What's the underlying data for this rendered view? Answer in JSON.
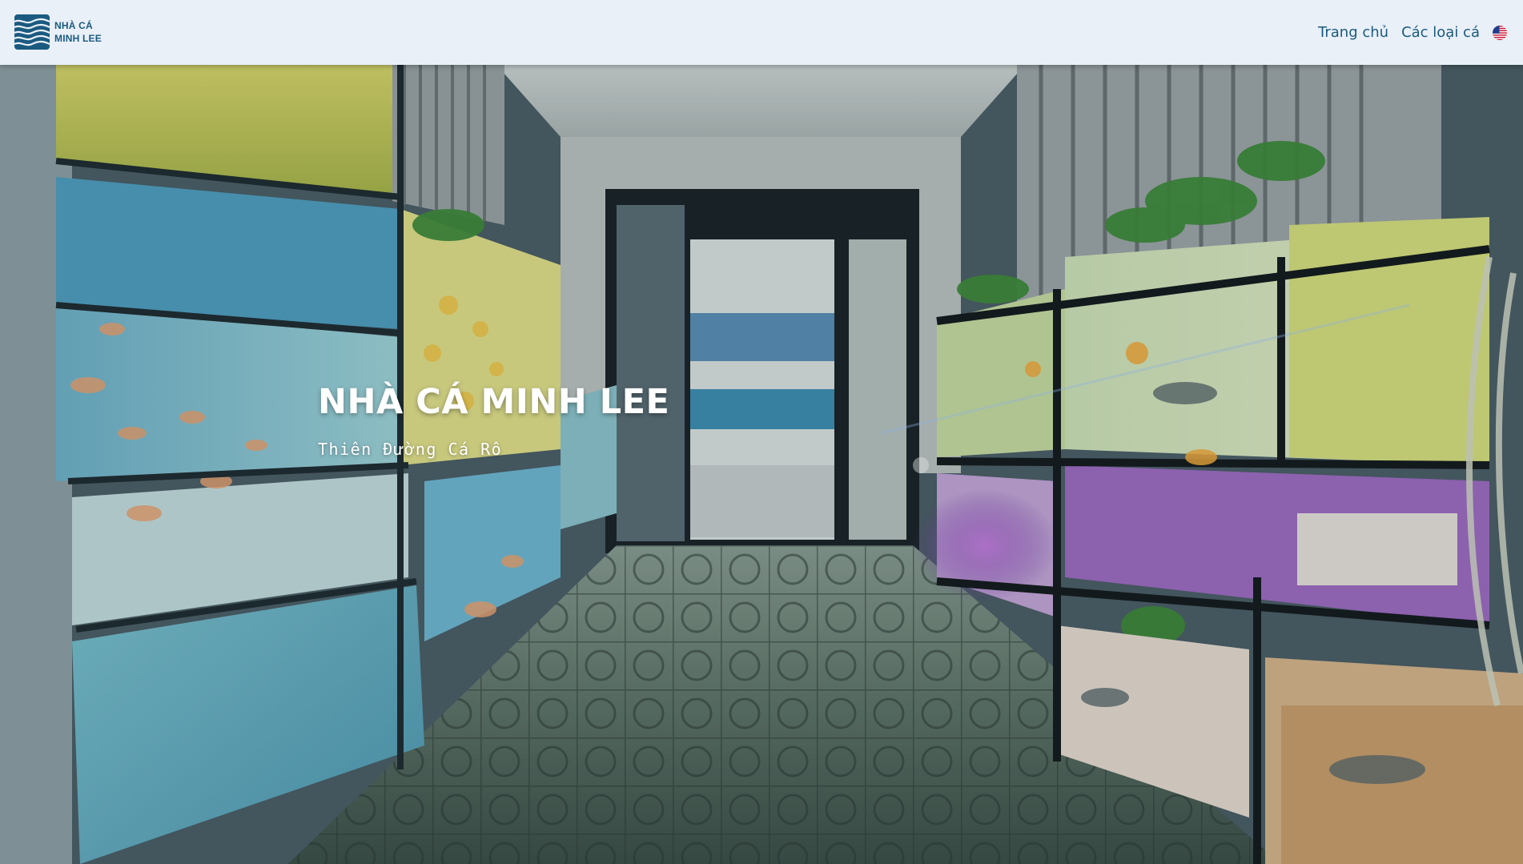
{
  "header": {
    "logo": {
      "line1": "NHÀ CÁ",
      "line2": "MINH LEE",
      "icon": "wave-logo-icon"
    },
    "nav": {
      "home_label": "Trang chủ",
      "fish_types_label": "Các loại cá",
      "language_icon": "us-flag-icon"
    }
  },
  "hero": {
    "title": "NHÀ CÁ MINH LEE",
    "subtitle": "Thiên Đường Cá Rô",
    "background": "photo of aquarium shop corridor with fish tanks"
  },
  "colors": {
    "header_bg": "#e9f0f8",
    "brand_blue": "#1b5a80",
    "hero_text": "#ffffff"
  }
}
